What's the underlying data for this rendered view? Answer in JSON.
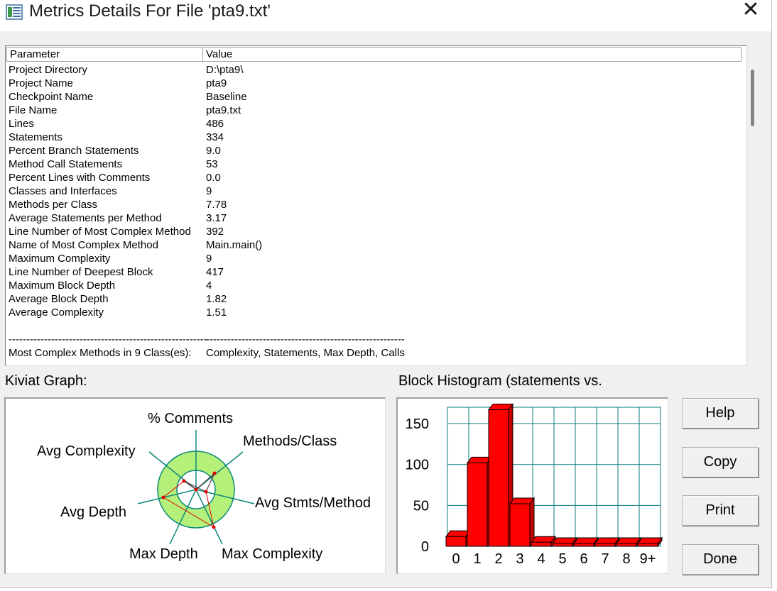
{
  "window": {
    "title": "Metrics Details For File 'pta9.txt'",
    "close_glyph": "✕"
  },
  "table": {
    "headers": {
      "parameter": "Parameter",
      "value": "Value"
    },
    "rows": [
      {
        "p": "Project Directory",
        "v": "D:\\pta9\\"
      },
      {
        "p": "Project Name",
        "v": "pta9"
      },
      {
        "p": "Checkpoint Name",
        "v": "Baseline"
      },
      {
        "p": "File Name",
        "v": "pta9.txt"
      },
      {
        "p": "Lines",
        "v": "486"
      },
      {
        "p": "Statements",
        "v": "334"
      },
      {
        "p": "Percent Branch Statements",
        "v": "9.0"
      },
      {
        "p": "Method Call Statements",
        "v": "53"
      },
      {
        "p": "Percent Lines with Comments",
        "v": "0.0"
      },
      {
        "p": "Classes and Interfaces",
        "v": "9"
      },
      {
        "p": "Methods per Class",
        "v": "7.78"
      },
      {
        "p": "Average Statements per Method",
        "v": "3.17"
      },
      {
        "p": "Line Number of Most Complex Method",
        "v": "392"
      },
      {
        "p": "Name of Most Complex Method",
        "v": "Main.main()"
      },
      {
        "p": "Maximum Complexity",
        "v": "9"
      },
      {
        "p": "Line Number of Deepest Block",
        "v": "417"
      },
      {
        "p": "Maximum Block Depth",
        "v": "4"
      },
      {
        "p": "Average Block Depth",
        "v": "1.82"
      },
      {
        "p": "Average Complexity",
        "v": "1.51"
      },
      {
        "p": "",
        "v": ""
      },
      {
        "p": "--------------------------------------------------------",
        "v": "--------------------------------------------------------"
      },
      {
        "p": "Most Complex Methods in 9 Class(es):",
        "v": "Complexity, Statements, Max Depth, Calls"
      }
    ]
  },
  "kiviat": {
    "label": "Kiviat Graph:",
    "axes": {
      "comments": "% Comments",
      "methods_class": "Methods/Class",
      "avg_stmts": "Avg Stmts/Method",
      "max_complexity": "Max Complexity",
      "max_depth": "Max Depth",
      "avg_depth": "Avg Depth",
      "avg_complexity": "Avg Complexity"
    }
  },
  "histogram": {
    "label": "Block Histogram (statements vs.",
    "chart_data": {
      "type": "bar",
      "categories": [
        "0",
        "1",
        "2",
        "3",
        "4",
        "5",
        "6",
        "7",
        "8",
        "9+"
      ],
      "values": [
        12,
        102,
        167,
        52,
        5,
        0,
        0,
        0,
        0,
        0
      ],
      "y_ticks": [
        "0",
        "50",
        "100",
        "150"
      ],
      "ylim": [
        0,
        170
      ],
      "bar_color": "#ff0000",
      "grid_color": "#0b7a7a"
    }
  },
  "buttons": {
    "help": "Help",
    "copy": "Copy",
    "print": "Print",
    "done": "Done"
  }
}
